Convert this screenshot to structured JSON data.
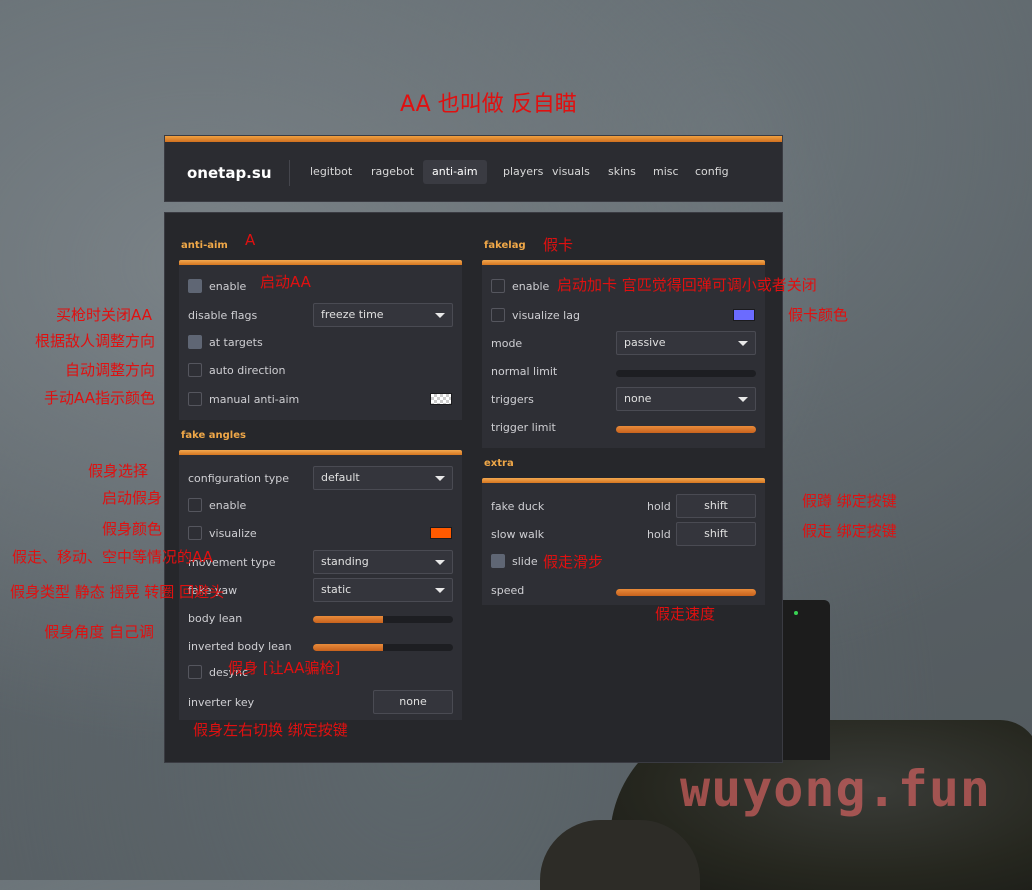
{
  "title_annotation": "AA 也叫做 反自瞄",
  "header": {
    "brand": "onetap.su",
    "tabs": [
      {
        "label": "legitbot",
        "active": false
      },
      {
        "label": "ragebot",
        "active": false
      },
      {
        "label": "anti-aim",
        "active": true
      },
      {
        "label": "players",
        "active": false
      },
      {
        "label": "visuals",
        "active": false
      },
      {
        "label": "skins",
        "active": false
      },
      {
        "label": "misc",
        "active": false
      },
      {
        "label": "config",
        "active": false
      }
    ]
  },
  "anti_aim": {
    "title": "anti-aim",
    "enable": {
      "label": "enable",
      "checked": true
    },
    "disable_flags": {
      "label": "disable flags",
      "value": "freeze time"
    },
    "at_targets": {
      "label": "at targets",
      "checked": true
    },
    "auto_direction": {
      "label": "auto direction",
      "checked": false
    },
    "manual": {
      "label": "manual anti-aim",
      "checked": false
    }
  },
  "fake_angles": {
    "title": "fake angles",
    "configuration_type": {
      "label": "configuration type",
      "value": "default"
    },
    "enable": {
      "label": "enable",
      "checked": false
    },
    "visualize": {
      "label": "visualize",
      "checked": false,
      "color": "#ff5a00"
    },
    "movement_type": {
      "label": "movement type",
      "value": "standing"
    },
    "fake_yaw": {
      "label": "fake yaw",
      "value": "static"
    },
    "body_lean": {
      "label": "body lean",
      "fraction": 0.5
    },
    "inverted_body_lean": {
      "label": "inverted body lean",
      "fraction": 0.5
    },
    "desync": {
      "label": "desync",
      "checked": false
    },
    "inverter_key": {
      "label": "inverter key",
      "value": "none"
    }
  },
  "fakelag": {
    "title": "fakelag",
    "enable": {
      "label": "enable",
      "checked": false
    },
    "visualize_lag": {
      "label": "visualize lag",
      "checked": false,
      "color": "#6b6bff"
    },
    "mode": {
      "label": "mode",
      "value": "passive"
    },
    "normal_limit": {
      "label": "normal limit",
      "fraction": 0.0
    },
    "triggers": {
      "label": "triggers",
      "value": "none"
    },
    "trigger_limit": {
      "label": "trigger limit",
      "fraction": 1.0
    }
  },
  "extra": {
    "title": "extra",
    "fake_duck": {
      "label": "fake duck",
      "mode": "hold",
      "key": "shift"
    },
    "slow_walk": {
      "label": "slow walk",
      "mode": "hold",
      "key": "shift"
    },
    "slide": {
      "label": "slide",
      "checked": true
    },
    "speed": {
      "label": "speed",
      "fraction": 1.0
    }
  },
  "annotations": {
    "a": "A",
    "enable_aa": "启动AA",
    "freeze": "买枪时关闭AA",
    "at_targets": "根据敌人调整方向",
    "auto_dir": "自动调整方向",
    "manual_color": "手动AA指示颜色",
    "fake_select": "假身选择",
    "fake_enable": "启动假身",
    "fake_color": "假身颜色",
    "movement": "假走、移动、空中等情况的AA",
    "fake_yaw": "假身类型 静态 摇晃 转圈 回避头",
    "lean": "假身角度 自己调",
    "desync": "假身 [让AA骗枪]",
    "inverter": "假身左右切换  绑定按键",
    "fakelag": "假卡",
    "fakelag_enable": "启动加卡 官匹觉得回弹可调小或者关闭",
    "fakelag_color": "假卡颜色",
    "fake_duck": "假蹲  绑定按键",
    "slow_walk": "假走  绑定按键",
    "slide": "假走滑步",
    "speed": "假走速度"
  },
  "watermark": "wuyong.fun"
}
